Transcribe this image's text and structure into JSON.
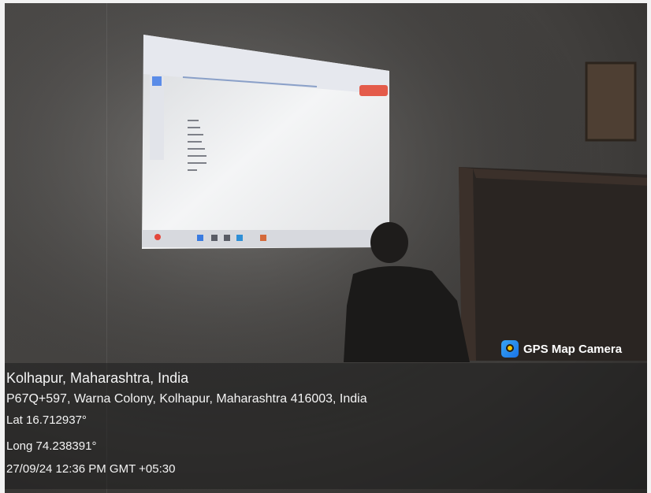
{
  "overlay": {
    "brand": "GPS Map Camera",
    "location_title": "Kolhapur, Maharashtra, India",
    "address": "P67Q+597, Warna Colony, Kolhapur, Maharashtra 416003, India",
    "latitude": "Lat 16.712937°",
    "longitude": "Long 74.238391°",
    "datetime": "27/09/24 12:36 PM GMT +05:30"
  },
  "projected_slide": {
    "heading": "Some Time Domain Measures and Similar Steps",
    "bullets": [
      "Signal",
      "Interval",
      "Amplitude",
      "Magnitude",
      "Energy Sums",
      "Sequence Period",
      "Response Period",
      "CNN"
    ]
  },
  "colors": {
    "gps_icon": "#1a73e8",
    "overlay_text": "#f4f4f4"
  }
}
